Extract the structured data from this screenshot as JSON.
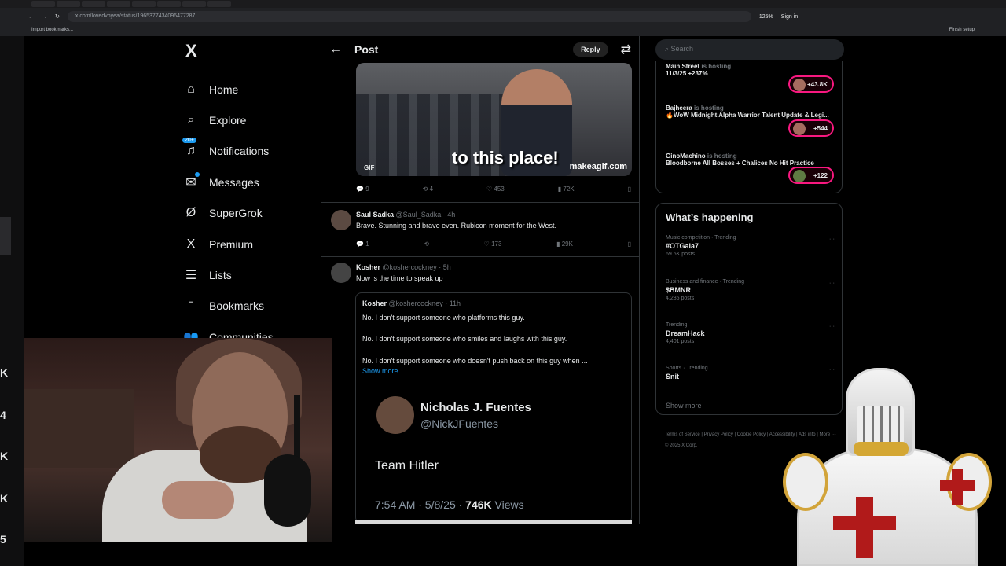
{
  "browser": {
    "url": "x.com/lovedvoyea/status/1965377434096477287",
    "bookmarks_label": "Import bookmarks...",
    "finish_label": "Finish setup",
    "zoom": "125%",
    "sign_in": "Sign in"
  },
  "left_strip": [
    "K",
    "4",
    "K",
    "K",
    "5"
  ],
  "nav": {
    "logo": "X",
    "items": [
      {
        "label": "Home",
        "icon": "home-icon"
      },
      {
        "label": "Explore",
        "icon": "search-icon"
      },
      {
        "label": "Notifications",
        "icon": "bell-icon",
        "badge": "20+"
      },
      {
        "label": "Messages",
        "icon": "mail-icon"
      },
      {
        "label": "SuperGrok",
        "icon": "grok-icon"
      },
      {
        "label": "Premium",
        "icon": "x-icon"
      },
      {
        "label": "Lists",
        "icon": "list-icon"
      },
      {
        "label": "Bookmarks",
        "icon": "bookmark-icon"
      },
      {
        "label": "Communities",
        "icon": "communities-icon"
      }
    ]
  },
  "post": {
    "title": "Post",
    "reply_button": "Reply",
    "gif": {
      "caption": "to this place!",
      "brand": "makeagif.com",
      "label": "GIF"
    },
    "stats": {
      "replies": "9",
      "reposts": "4",
      "likes": "453",
      "views": "72K"
    }
  },
  "tweets": [
    {
      "name": "Saul Sadka",
      "handle": "@Saul_Sadka · 4h",
      "text": "Brave. Stunning and brave even. Rubicon moment for the West.",
      "replies": "1",
      "reposts": "",
      "likes": "173",
      "views": "29K"
    },
    {
      "name": "Kosher",
      "handle": "@koshercockney · 5h",
      "text": "Now is the time to speak up"
    }
  ],
  "quote": {
    "name": "Kosher",
    "handle": "@koshercockney · 11h",
    "lines": [
      "No. I don't support someone who platforms this guy.",
      "No. I don't support someone who smiles and laughs with this guy.",
      "No. I don't support someone who doesn't push back on this guy when ..."
    ],
    "show_more": "Show more"
  },
  "embed": {
    "name": "Nicholas J. Fuentes",
    "handle": "@NickJFuentes",
    "text": "Team Hitler",
    "meta": "7:54 AM · 5/8/25 · ",
    "views_count": "746K",
    "views_label": " Views"
  },
  "right": {
    "search_placeholder": "Search",
    "spaces": [
      {
        "host": "Main Street",
        "status": "is hosting",
        "title": "11/3/25 +237%",
        "pill": "+43.8K"
      },
      {
        "host": "Bajheera",
        "status": "is hosting",
        "title": "🔥WoW Midnight Alpha Warrior Talent Update & Legi...",
        "pill": "+544"
      },
      {
        "host": "GinoMachino",
        "status": "is hosting",
        "title": "Bloodborne All Bosses + Chalices No Hit Practice",
        "pill": "+122"
      }
    ],
    "happening_title": "What’s happening",
    "trends": [
      {
        "context": "Music competition · Trending",
        "name": "#OTGala7",
        "posts": "69.6K posts"
      },
      {
        "context": "Business and finance · Trending",
        "name": "$BMNR",
        "posts": "4,285 posts"
      },
      {
        "context": "Trending",
        "name": "DreamHack",
        "posts": "4,401 posts"
      },
      {
        "context": "Sports · Trending",
        "name": "Snit",
        "posts": ""
      }
    ],
    "show_more": "Show more",
    "footer": "Terms of Service | Privacy Policy | Cookie Policy | Accessibility | Ads info | More ··· © 2025 X Corp."
  }
}
